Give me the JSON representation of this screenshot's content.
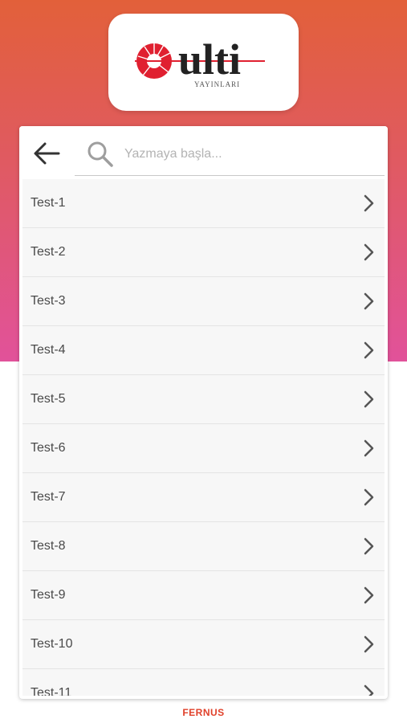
{
  "brand": {
    "logo_name": "ulti",
    "logo_subtitle": "YAYINLARI",
    "accent": "#e02030",
    "gradient_top": "#e2603a",
    "gradient_bottom": "#e1529a"
  },
  "search": {
    "back_icon": "arrow-left-icon",
    "search_icon": "magnifier-icon",
    "placeholder": "Yazmaya başla...",
    "value": ""
  },
  "list": {
    "items": [
      {
        "label": "Test-1"
      },
      {
        "label": "Test-2"
      },
      {
        "label": "Test-3"
      },
      {
        "label": "Test-4"
      },
      {
        "label": "Test-5"
      },
      {
        "label": "Test-6"
      },
      {
        "label": "Test-7"
      },
      {
        "label": "Test-8"
      },
      {
        "label": "Test-9"
      },
      {
        "label": "Test-10"
      },
      {
        "label": "Test-11"
      }
    ],
    "item_icon": "chevron-right-icon"
  },
  "footer": {
    "brand": "FERNUS",
    "color": "#e0402a"
  }
}
